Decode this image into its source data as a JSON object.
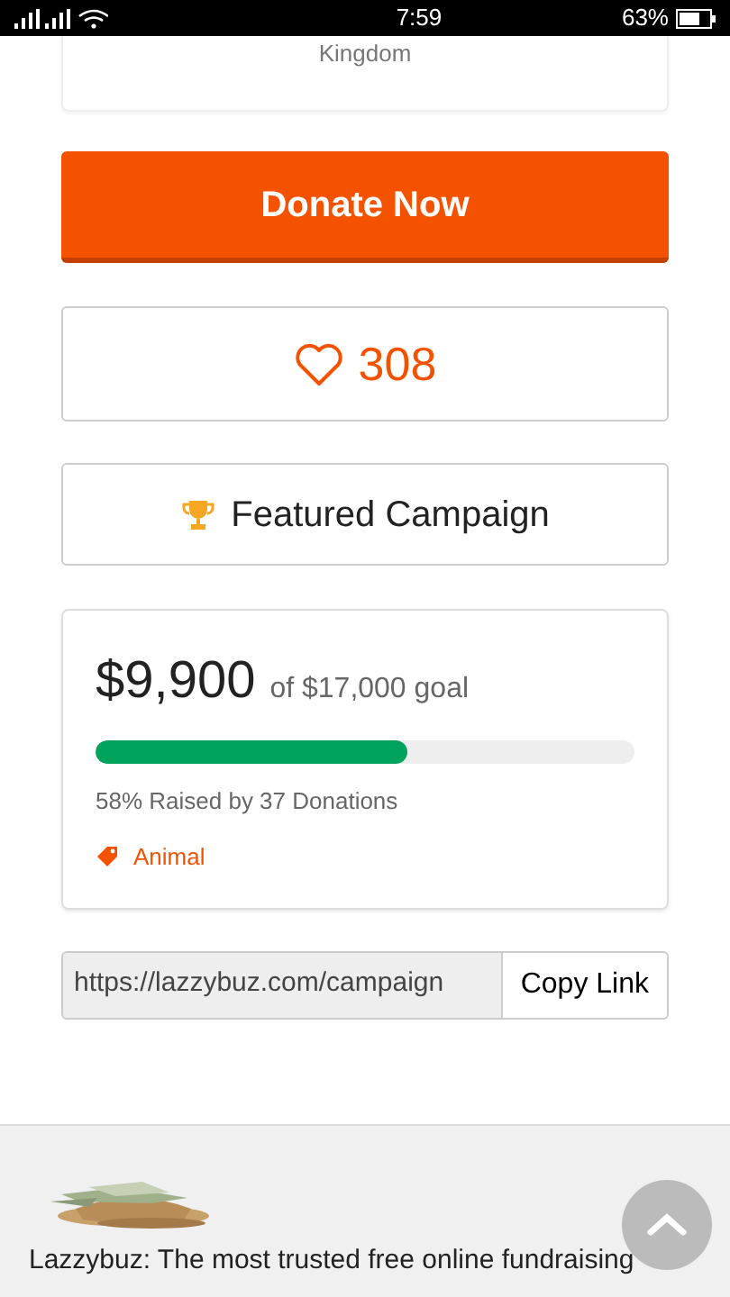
{
  "status_bar": {
    "time": "7:59",
    "battery": "63%"
  },
  "location_card": {
    "text": "Kingdom"
  },
  "donate_button": {
    "label": "Donate Now"
  },
  "likes": {
    "count": "308"
  },
  "featured": {
    "label": "Featured Campaign"
  },
  "stats": {
    "raised": "$9,900",
    "goal": "of $17,000 goal",
    "level": 0.58,
    "summary": "58% Raised by 37 Donations",
    "category": "Animal"
  },
  "share": {
    "url": "https://lazzybuz.com/campaign",
    "button": "Copy Link"
  },
  "footer": {
    "text": "Lazzybuz: The most trusted free online fundraising"
  }
}
